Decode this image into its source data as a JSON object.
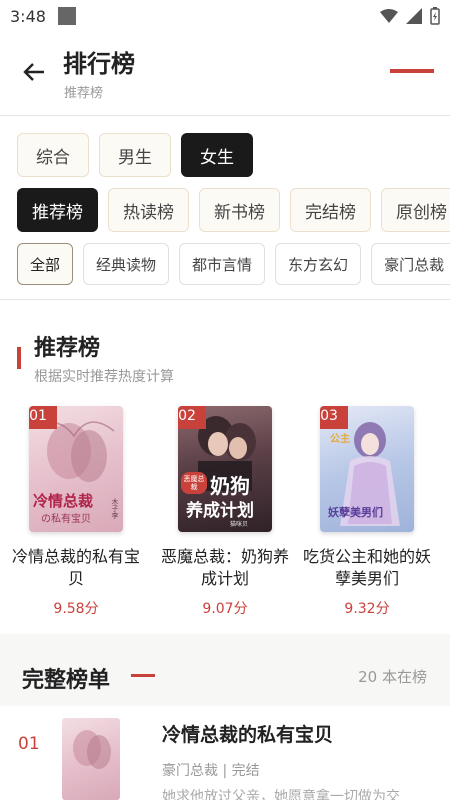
{
  "status_bar": {
    "time": "3:48"
  },
  "header": {
    "title": "排行榜",
    "subtitle": "推荐榜"
  },
  "filters": {
    "gender": [
      {
        "label": "综合",
        "active": false
      },
      {
        "label": "男生",
        "active": false
      },
      {
        "label": "女生",
        "active": true
      }
    ],
    "lists": [
      {
        "label": "推荐榜",
        "active": true
      },
      {
        "label": "热读榜",
        "active": false
      },
      {
        "label": "新书榜",
        "active": false
      },
      {
        "label": "完结榜",
        "active": false
      },
      {
        "label": "原创榜",
        "active": false
      }
    ],
    "categories": [
      {
        "label": "全部",
        "active": true
      },
      {
        "label": "经典读物",
        "active": false
      },
      {
        "label": "都市言情",
        "active": false
      },
      {
        "label": "东方玄幻",
        "active": false
      },
      {
        "label": "豪门总裁",
        "active": false
      }
    ]
  },
  "recommend": {
    "title": "推荐榜",
    "subtitle": "根据实时推荐热度计算",
    "books": [
      {
        "rank": "01",
        "title": "冷情总裁的私有宝贝",
        "score": "9.58分",
        "cover_text": "冷情总裁",
        "cover_sub": "の私有宝贝",
        "cover_author": "木子李",
        "cover_color": "#e9c9d3"
      },
      {
        "rank": "02",
        "title": "恶魔总裁：奶狗养成计划",
        "score": "9.07分",
        "cover_text": "奶狗",
        "cover_sub": "养成计划",
        "cover_badge": "恶魔总裁",
        "cover_author": "猫咪贝",
        "cover_color": "#5a3f46"
      },
      {
        "rank": "03",
        "title": "吃货公主和她的妖孽美男们",
        "score": "9.32分",
        "cover_text": "妖孽美男们",
        "cover_sub": "公主",
        "cover_color": "#b7c7e6"
      }
    ]
  },
  "full_list": {
    "title": "完整榜单",
    "count": "20 本在榜",
    "items": [
      {
        "rank": "01",
        "title": "冷情总裁的私有宝贝",
        "category": "豪门总裁",
        "status": "完结",
        "desc": "她求他放过父亲，她愿意拿一切做为交"
      }
    ]
  },
  "colors": {
    "accent": "#c9413b",
    "active_chip": "#1a1a1a",
    "chip_bg": "#fcfaf5"
  }
}
